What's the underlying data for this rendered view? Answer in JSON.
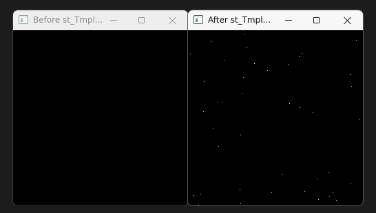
{
  "windows": {
    "before": {
      "title": "Before st_Tmpl..."
    },
    "after": {
      "title": "After st_Tmpl..."
    }
  }
}
